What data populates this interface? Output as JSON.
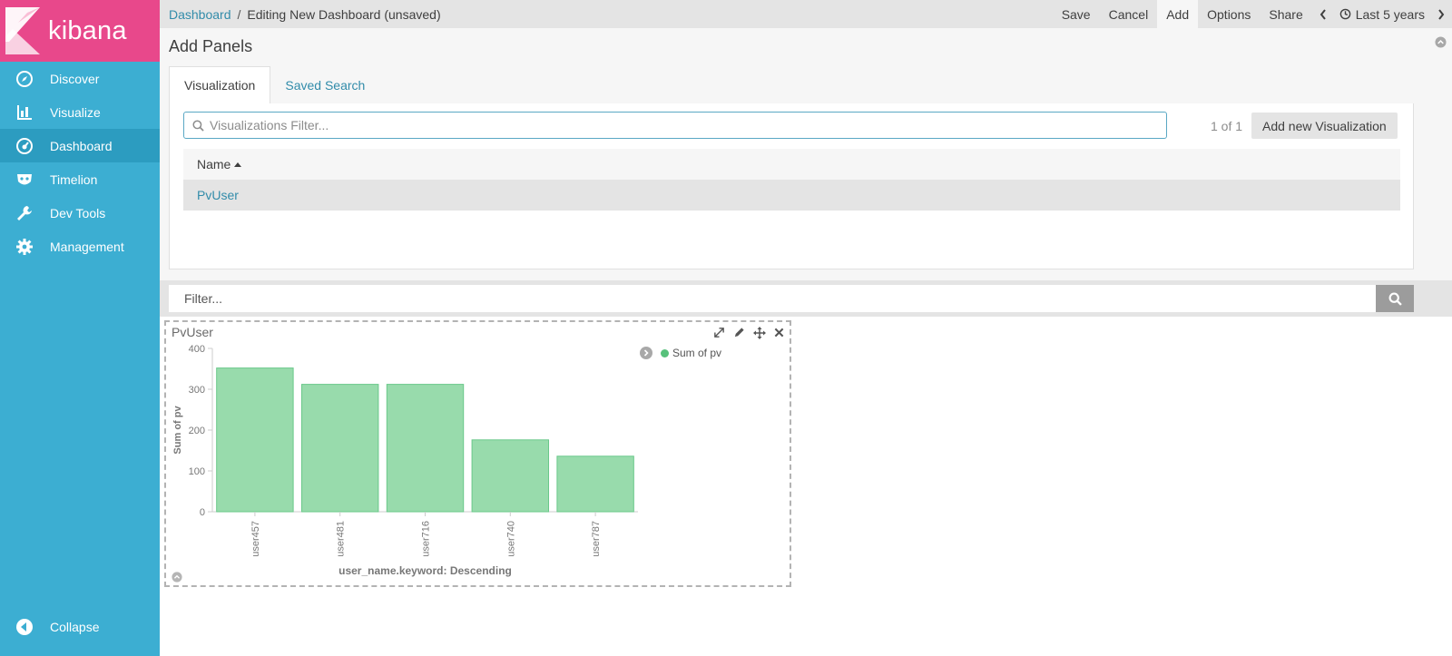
{
  "app": {
    "name": "kibana",
    "brand_color": "#e8488b",
    "sidebar_color": "#3caed2"
  },
  "sidebar": {
    "items": [
      {
        "label": "Discover",
        "icon": "compass-icon"
      },
      {
        "label": "Visualize",
        "icon": "bar-chart-icon"
      },
      {
        "label": "Dashboard",
        "icon": "dashboard-gauge-icon",
        "active": true
      },
      {
        "label": "Timelion",
        "icon": "timelion-mask-icon"
      },
      {
        "label": "Dev Tools",
        "icon": "wrench-icon"
      },
      {
        "label": "Management",
        "icon": "gear-icon"
      }
    ],
    "collapse_label": "Collapse"
  },
  "topbar": {
    "breadcrumb_root": "Dashboard",
    "breadcrumb_sep": "/",
    "breadcrumb_current": "Editing New Dashboard (unsaved)",
    "menu": {
      "save": "Save",
      "cancel": "Cancel",
      "add": "Add",
      "options": "Options",
      "share": "Share"
    },
    "time_range": "Last 5 years"
  },
  "add_panels": {
    "title": "Add Panels",
    "tabs": {
      "visualization": "Visualization",
      "saved_search": "Saved Search"
    },
    "filter_placeholder": "Visualizations Filter...",
    "pager": "1 of 1",
    "add_new_label": "Add new Visualization",
    "column_name": "Name",
    "rows": [
      "PvUser"
    ]
  },
  "query_bar": {
    "placeholder": "Filter..."
  },
  "panel": {
    "title": "PvUser",
    "legend_label": "Sum of pv"
  },
  "chart_data": {
    "type": "bar",
    "categories": [
      "user457",
      "user481",
      "user716",
      "user740",
      "user787"
    ],
    "series": [
      {
        "name": "Sum of pv",
        "values": [
          352,
          312,
          312,
          176,
          136
        ]
      }
    ],
    "ylabel": "Sum of pv",
    "xlabel": "user_name.keyword: Descending",
    "ylim": [
      0,
      400
    ],
    "yticks": [
      0,
      100,
      200,
      300,
      400
    ],
    "bar_color": "#98dbac",
    "bar_stroke": "#6ac88a",
    "legend": "top-right"
  }
}
